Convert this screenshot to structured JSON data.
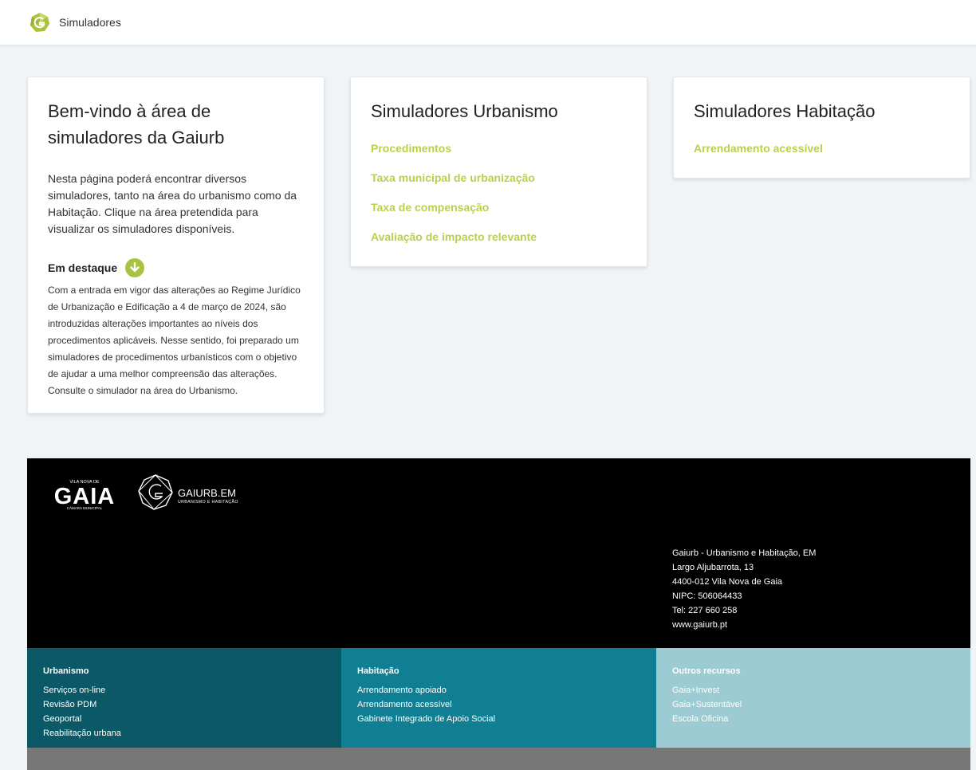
{
  "header": {
    "title": "Simuladores",
    "logo_icon": "gaiurb-logo-icon"
  },
  "welcome": {
    "title": "Bem-vindo à área de simuladores da Gaiurb",
    "intro": "Nesta página poderá encontrar diversos simuladores, tanto na área do urbanismo como da Habitação. Clique na área pretendida para visualizar os simuladores disponíveis.",
    "highlight_title": "Em destaque",
    "highlight_icon": "arrow-down-circle-icon",
    "highlight_text": "Com a entrada em vigor das alterações ao Regime Jurídico de Urbanização e Edificação a 4 de março de 2024, são introduzidas alterações importantes ao níveis dos procedimentos aplicáveis. Nesse sentido, foi preparado um simuladores de procedimentos urbanísticos com o objetivo de ajudar a uma melhor compreensão das alterações. Consulte o simulador na área do Urbanismo."
  },
  "urbanismo": {
    "title": "Simuladores Urbanismo",
    "links": [
      "Procedimentos",
      "Taxa municipal de urbanização",
      "Taxa de compensação",
      "Avaliação de impacto relevante"
    ]
  },
  "habitacao": {
    "title": "Simuladores Habitação",
    "links": [
      "Arrendamento acessível"
    ]
  },
  "footer": {
    "logo_gaia_top": "VILA NOVA DE",
    "logo_gaia_main": "GAIA",
    "logo_gaia_bottom": "CÂMARA MUNICIPAL",
    "logo_gaiurb_main": "GAIURB.EM",
    "logo_gaiurb_sub": "URBANISMO E HABITAÇÃO",
    "address": [
      "Gaiurb - Urbanismo e Habitação, EM",
      "Largo Aljubarrota, 13",
      "4400-012 Vila Nova de Gaia",
      "NIPC: 506064433",
      "Tel: 227 660 258",
      "www.gaiurb.pt"
    ],
    "columns": [
      {
        "title": "Urbanismo",
        "links": [
          "Serviços on-line",
          "Revisão PDM",
          "Geoportal",
          "Reabilitação urbana"
        ]
      },
      {
        "title": "Habitação",
        "links": [
          "Arrendamento apoiado",
          "Arrendamento acessível",
          "Gabinete Integrado de Apoio Social"
        ]
      },
      {
        "title": "Outros recursos",
        "links": [
          "Gaia+Invest",
          "Gaia+Sustentável",
          "Escola Oficina"
        ]
      }
    ]
  },
  "colors": {
    "accent": "#b8d14a",
    "footer_dark_teal": "#0b5966",
    "footer_teal": "#107f93",
    "footer_light_teal": "#9dcbd3"
  }
}
